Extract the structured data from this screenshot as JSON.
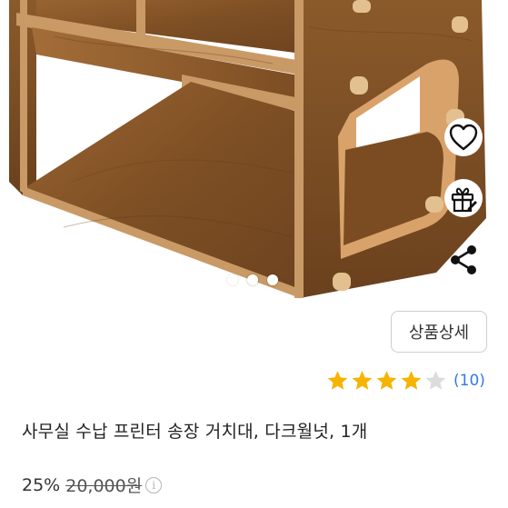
{
  "product": {
    "image_indicator": {
      "count": 3,
      "active_index": 0
    },
    "side_actions": [
      {
        "name": "wishlist",
        "icon": "heart-icon"
      },
      {
        "name": "gift",
        "icon": "gift-icon"
      },
      {
        "name": "share",
        "icon": "share-icon"
      }
    ],
    "detail_button_label": "상품상세",
    "rating": {
      "stars_filled": 4,
      "stars_total": 5,
      "review_count_label": "(10)"
    },
    "title": "사무실 수납 프린터 송장 거치대, 다크월넛, 1개",
    "price": {
      "discount_label": "25%",
      "original_price_label": "20,000원"
    }
  },
  "colors": {
    "wood": "#8a5a2b",
    "wood_dark": "#6b4220",
    "wood_edge": "#c99a66",
    "star_filled": "#f6b300",
    "star_empty": "#dcdcdc",
    "review_link": "#3579e8"
  }
}
